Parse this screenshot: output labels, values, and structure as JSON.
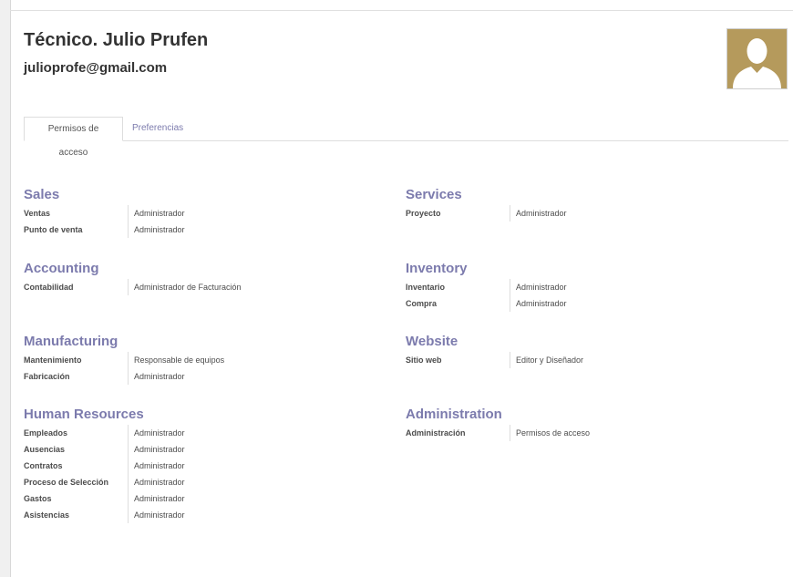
{
  "user": {
    "name": "Técnico. Julio Prufen",
    "email": "julioprofe@gmail.com",
    "avatar_color": "#b59a5c"
  },
  "tabs": [
    {
      "label": "Permisos de acceso",
      "active": true
    },
    {
      "label": "Preferencias",
      "active": false
    }
  ],
  "groups": {
    "sales": {
      "title": "Sales",
      "rows": [
        {
          "label": "Ventas",
          "value": "Administrador"
        },
        {
          "label": "Punto de venta",
          "value": "Administrador"
        }
      ]
    },
    "services": {
      "title": "Services",
      "rows": [
        {
          "label": "Proyecto",
          "value": "Administrador"
        }
      ]
    },
    "accounting": {
      "title": "Accounting",
      "rows": [
        {
          "label": "Contabilidad",
          "value": "Administrador de Facturación"
        }
      ]
    },
    "inventory": {
      "title": "Inventory",
      "rows": [
        {
          "label": "Inventario",
          "value": "Administrador"
        },
        {
          "label": "Compra",
          "value": "Administrador"
        }
      ]
    },
    "manufacturing": {
      "title": "Manufacturing",
      "rows": [
        {
          "label": "Mantenimiento",
          "value": "Responsable de equipos"
        },
        {
          "label": "Fabricación",
          "value": "Administrador"
        }
      ]
    },
    "website": {
      "title": "Website",
      "rows": [
        {
          "label": "Sitio web",
          "value": "Editor y Diseñador"
        }
      ]
    },
    "human_resources": {
      "title": "Human Resources",
      "rows": [
        {
          "label": "Empleados",
          "value": "Administrador"
        },
        {
          "label": "Ausencias",
          "value": "Administrador"
        },
        {
          "label": "Contratos",
          "value": "Administrador"
        },
        {
          "label": "Proceso de Selección",
          "value": "Administrador"
        },
        {
          "label": "Gastos",
          "value": "Administrador"
        },
        {
          "label": "Asistencias",
          "value": "Administrador"
        }
      ]
    },
    "administration": {
      "title": "Administration",
      "rows": [
        {
          "label": "Administración",
          "value": "Permisos de acceso"
        }
      ]
    }
  }
}
